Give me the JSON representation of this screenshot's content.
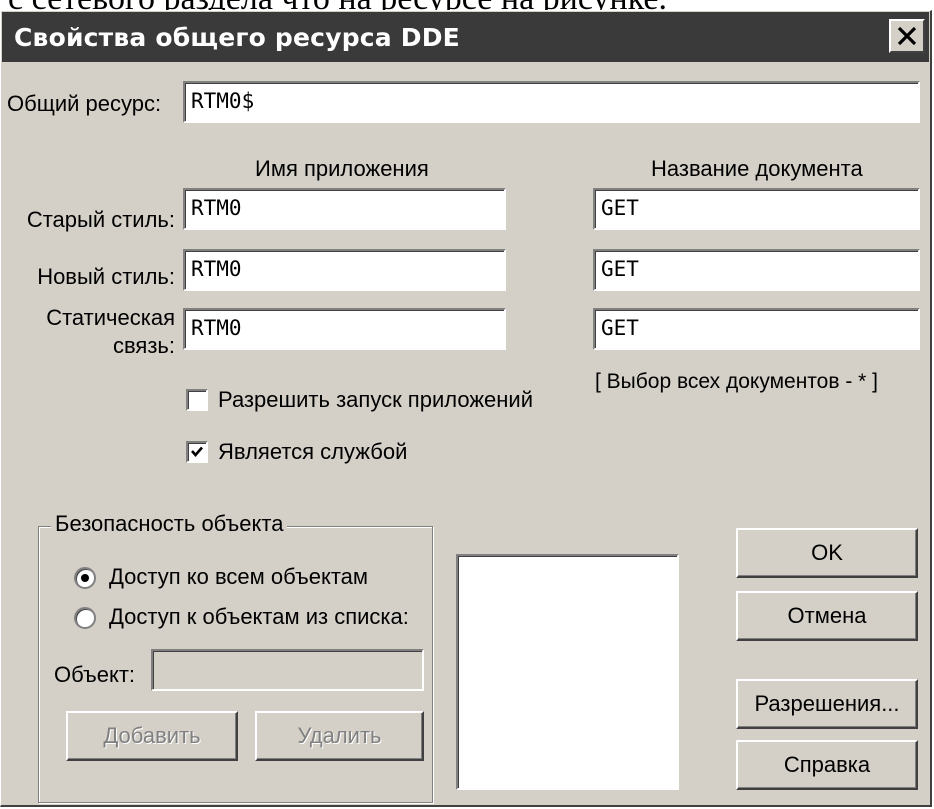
{
  "dialog": {
    "title": "Свойства общего ресурса DDE",
    "close_icon": "close-icon"
  },
  "share": {
    "label": "Общий ресурс:",
    "value": "RTM0$"
  },
  "columns": {
    "app_name": "Имя приложения",
    "doc_name": "Название документа"
  },
  "rows": {
    "old_style": {
      "label": "Старый стиль:",
      "app": "RTM0",
      "doc": "GET"
    },
    "new_style": {
      "label": "Новый стиль:",
      "app": "RTM0",
      "doc": "GET"
    },
    "static_link": {
      "label_line1": "Статическая",
      "label_line2": "связь:",
      "app": "RTM0",
      "doc": "GET"
    }
  },
  "hint": "[ Выбор всех документов - * ]",
  "options": {
    "allow_start": {
      "label": "Разрешить запуск приложений",
      "checked": false
    },
    "is_service": {
      "label": "Является службой",
      "checked": true
    }
  },
  "security": {
    "group_title": "Безопасность объекта",
    "access_all": {
      "label": "Доступ ко всем объектам",
      "selected": true
    },
    "access_list": {
      "label": "Доступ к объектам из списка:",
      "selected": false
    },
    "object_label": "Объект:",
    "object_value": "",
    "add_button": "Добавить",
    "remove_button": "Удалить"
  },
  "buttons": {
    "ok": "OK",
    "cancel": "Отмена",
    "permissions": "Разрешения...",
    "help": "Справка"
  }
}
